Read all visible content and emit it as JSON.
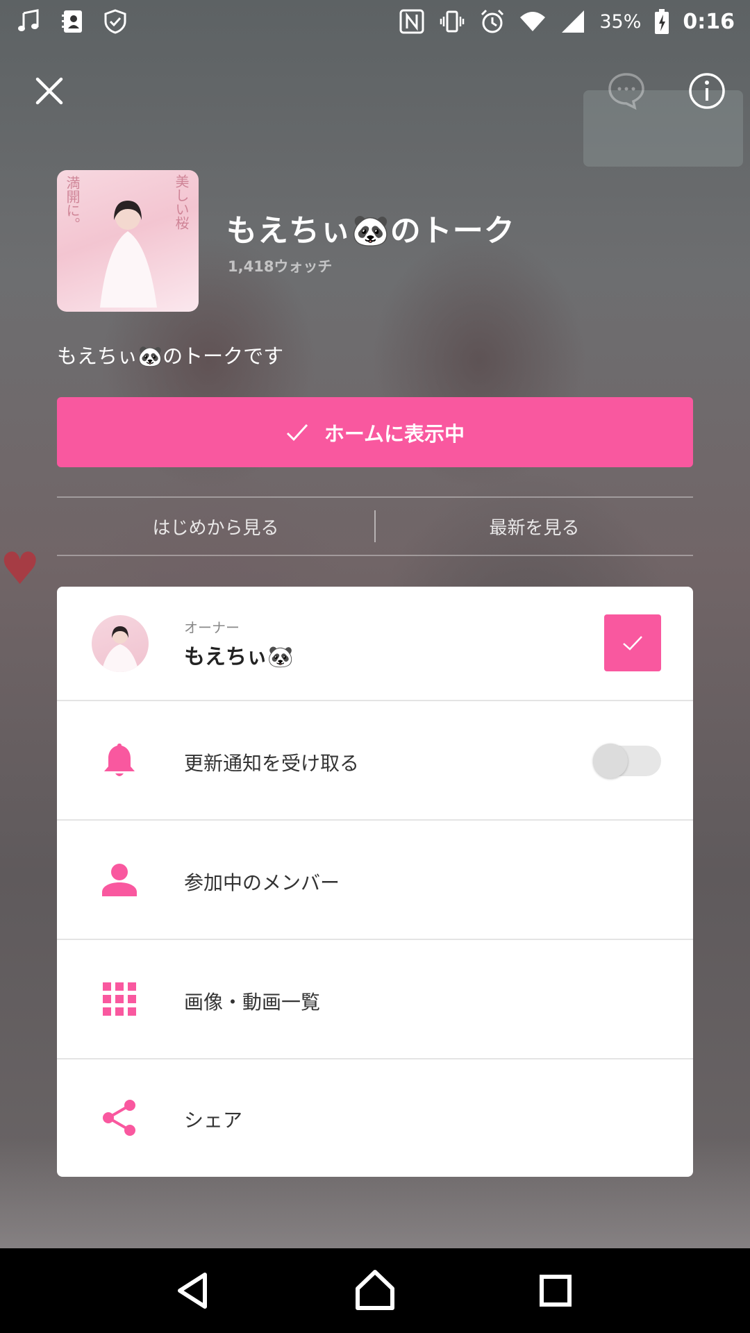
{
  "status_bar": {
    "battery": "35%",
    "time": "0:16",
    "left_icons": [
      "music-icon",
      "contacts-icon",
      "shield-icon"
    ],
    "right_icons": [
      "nfc-icon",
      "vibrate-icon",
      "alarm-icon",
      "wifi-icon",
      "signal-icon",
      "battery-icon"
    ]
  },
  "header": {
    "title": "もえちぃ🐼のトーク",
    "watch_count": "1,418ウォッチ",
    "description": "もえちぃ🐼のトークです",
    "cover_text_1": "美しい桜",
    "cover_text_2": "満開に。"
  },
  "home_button": {
    "label": "ホームに表示中"
  },
  "view_links": {
    "from_start": "はじめから見る",
    "latest": "最新を見る"
  },
  "panel": {
    "owner_label": "オーナー",
    "owner_name": "もえちぃ🐼",
    "notify_label": "更新通知を受け取る",
    "notify_enabled": false,
    "members_label": "参加中のメンバー",
    "media_label": "画像・動画一覧",
    "share_label": "シェア"
  },
  "colors": {
    "accent": "#f9589f",
    "panel_bg": "#ffffff",
    "nav_bg": "#000000"
  }
}
